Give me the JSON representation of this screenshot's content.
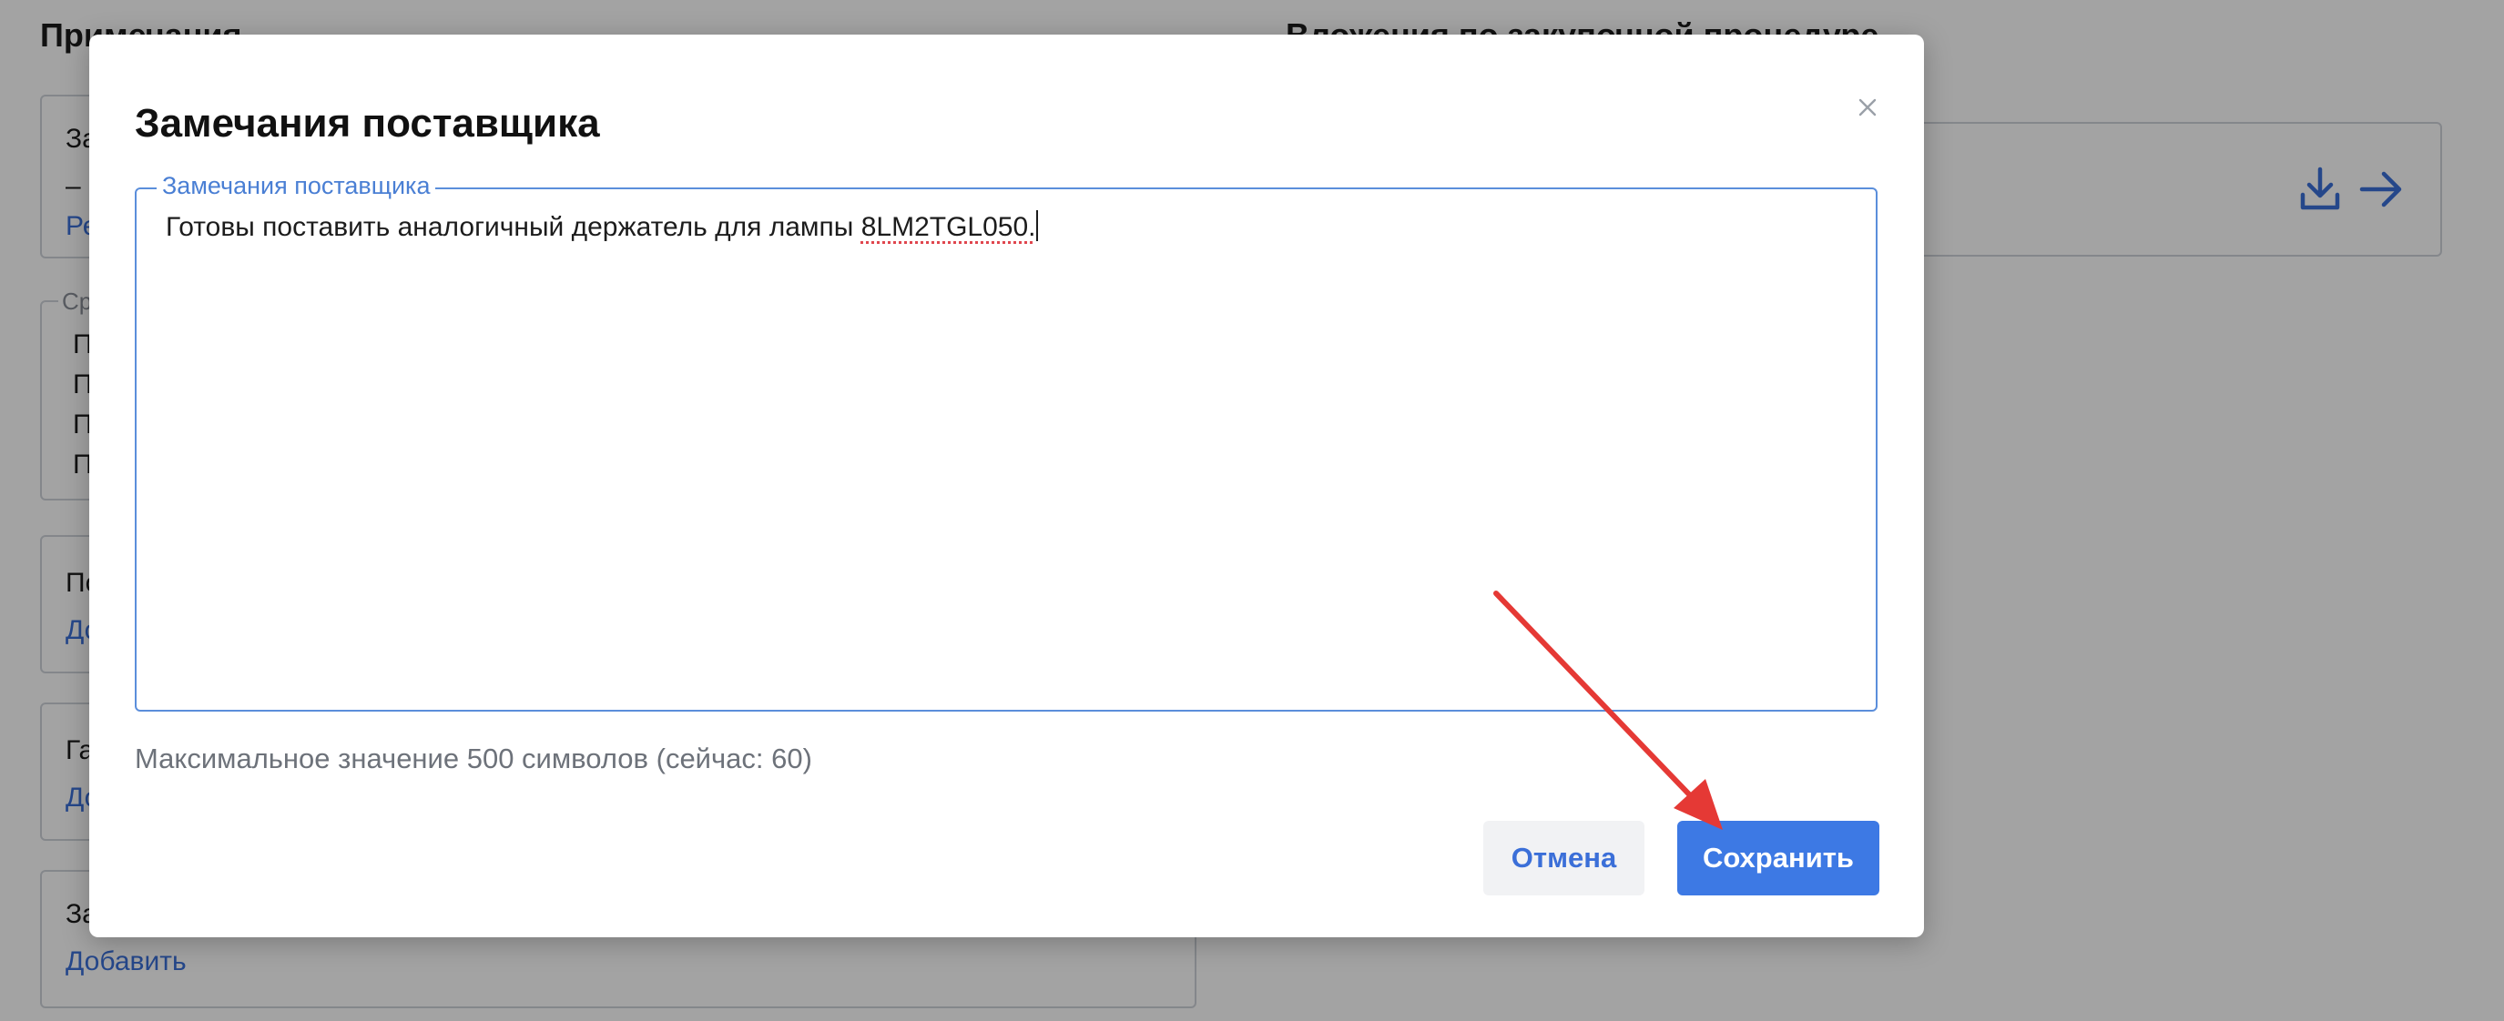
{
  "background": {
    "left_heading": "Примечания",
    "right_heading": "Вложения по закупочной процедуре",
    "cards": [
      {
        "title": "За",
        "dash": "–",
        "link": "Ре"
      },
      {
        "title": "По",
        "link": "До"
      },
      {
        "title": "Га",
        "link": "До"
      },
      {
        "title": "За",
        "link": "Добавить"
      }
    ],
    "fieldset": {
      "legend": "Ср",
      "items": [
        "П",
        "П",
        "П",
        "П"
      ]
    },
    "attachment_icons": [
      "download-icon",
      "arrow-right-icon"
    ]
  },
  "modal": {
    "title": "Замечания поставщика",
    "close_icon": "close-icon",
    "field": {
      "legend": "Замечания поставщика",
      "value_plain": "Готовы поставить аналогичный держатель для лампы ",
      "value_flagged": "8LM2TGL050."
    },
    "helper_text": "Максимальное значение 500 символов (сейчас: 60)",
    "buttons": {
      "cancel": "Отмена",
      "save": "Сохранить"
    }
  },
  "colors": {
    "accent": "#3d79e4",
    "link": "#3b6fd8",
    "annotation_arrow": "#e53935"
  }
}
